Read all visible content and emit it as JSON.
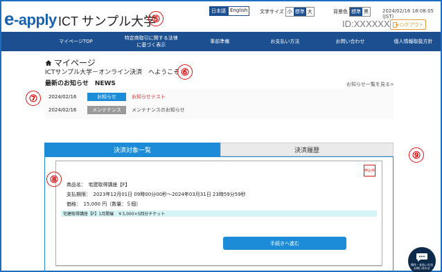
{
  "header": {
    "logo_main": "e",
    "logo_sub": "-apply",
    "university": "ICT サンプル大学",
    "marker": "⑤",
    "lang": [
      "日本語",
      "English"
    ],
    "font_size_label": "文字サイズ",
    "font_sizes": [
      "小",
      "標準",
      "大"
    ],
    "bg_label": "背景色",
    "bg_options": [
      "標準",
      "黒"
    ],
    "datetime": "2024/02/16 18:08:05 (JST)",
    "user_id": "ID:XXXXXX",
    "logout": "ログアウト"
  },
  "nav": [
    "マイページTOP",
    "特定商取引に関する法律\nに基づく表示",
    "事前準備",
    "お支払い方法",
    "お問い合わせ",
    "個人情報取扱方針"
  ],
  "page": {
    "title": "マイページ",
    "welcome": "ICTサンプル大学－オンライン決済　へようこそ",
    "marker6": "⑥",
    "news_heading": "最新のお知らせ　NEWS",
    "news_link": "お知らせ一覧を見る>",
    "marker7": "⑦",
    "news": [
      {
        "date": "2024/02/16",
        "tag": "お知らせ",
        "text": "お知らせテスト"
      },
      {
        "date": "2024/02/16",
        "tag": "メンテナンス",
        "text": "メンテナンスのお知らせ"
      }
    ],
    "marker9": "⑨"
  },
  "tabs": [
    "決済対象一覧",
    "決済履歴"
  ],
  "item": {
    "marker8": "⑧",
    "badge": "申込中",
    "name": "商品名：　宅建取得講座【F】",
    "period": "支払期限：　2023年12月01日 09時00分00秒～2024年03月31日 23時59分59秒",
    "price": "価格：　15,000 円（数量：５個）",
    "ticket": "宅建取得講座【F】1月開催　￥3,000×5回分チケット",
    "button": "手続きへ進む"
  },
  "chat": {
    "label": "操作・支払い方法\nお問い合わせ"
  },
  "colors": {
    "brand": "#1c4f90",
    "accent": "#1d8cd8",
    "marker": "#dd1111",
    "news_tag": "#1d8cd8",
    "maint_tag": "#9a9a9a"
  }
}
